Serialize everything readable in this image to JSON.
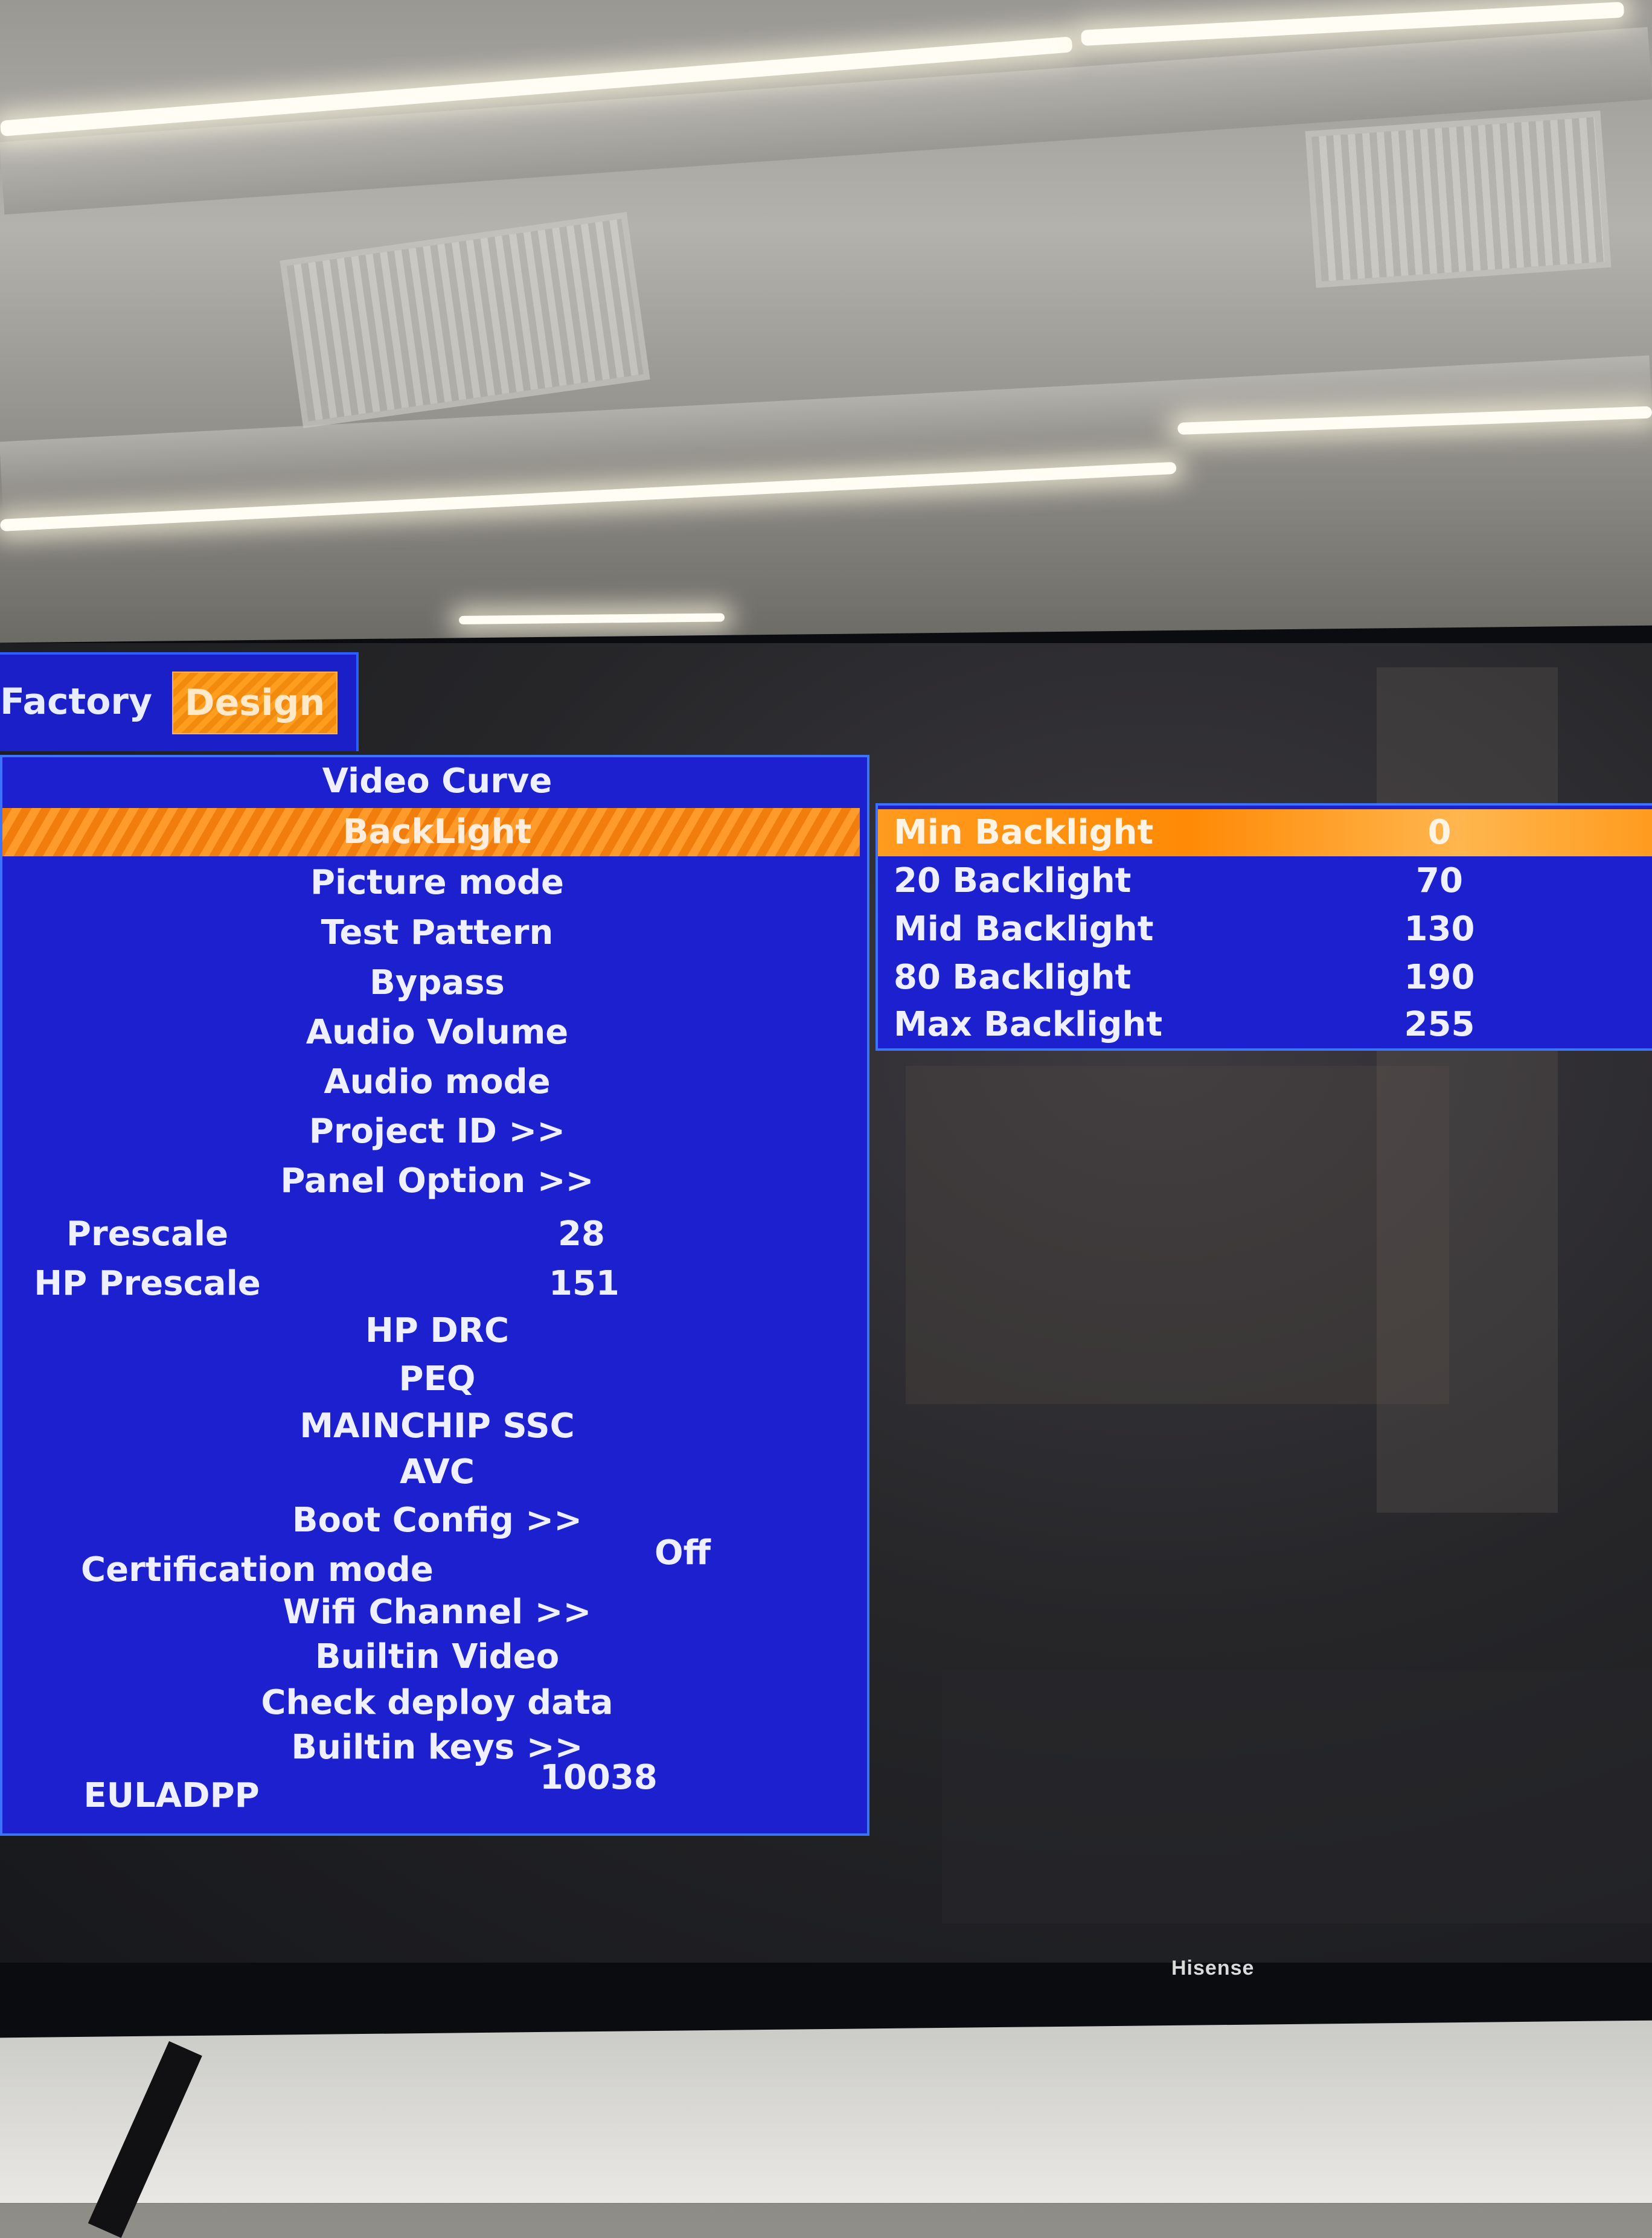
{
  "menu": {
    "tabs": [
      {
        "label": "Factory",
        "selected": false
      },
      {
        "label": "Design",
        "selected": true
      }
    ],
    "items": [
      {
        "label": "Video Curve",
        "value": "",
        "selected": false
      },
      {
        "label": "BackLight",
        "value": "",
        "selected": true
      },
      {
        "label": "Picture mode",
        "value": "",
        "selected": false
      },
      {
        "label": "Test Pattern",
        "value": "",
        "selected": false
      },
      {
        "label": "Bypass",
        "value": "",
        "selected": false
      },
      {
        "label": "Audio Volume",
        "value": "",
        "selected": false
      },
      {
        "label": "Audio mode",
        "value": "",
        "selected": false
      },
      {
        "label": "Project ID >>",
        "value": "",
        "selected": false
      },
      {
        "label": "Panel Option >>",
        "value": "",
        "selected": false
      },
      {
        "label": "Prescale",
        "value": "28",
        "selected": false
      },
      {
        "label": "HP Prescale",
        "value": "151",
        "selected": false
      },
      {
        "label": "HP DRC",
        "value": "",
        "selected": false
      },
      {
        "label": "PEQ",
        "value": "",
        "selected": false
      },
      {
        "label": "MAINCHIP SSC",
        "value": "",
        "selected": false
      },
      {
        "label": "AVC",
        "value": "",
        "selected": false
      },
      {
        "label": "Boot Config >>",
        "value": "",
        "selected": false
      },
      {
        "label": "Certification mode",
        "value": "Off",
        "selected": false
      },
      {
        "label": "Wifi Channel >>",
        "value": "",
        "selected": false
      },
      {
        "label": "Builtin  Video",
        "value": "",
        "selected": false
      },
      {
        "label": "Check deploy data",
        "value": "",
        "selected": false
      },
      {
        "label": "Builtin keys >>",
        "value": "",
        "selected": false
      },
      {
        "label": "EULADPP",
        "value": "10038",
        "selected": false
      }
    ]
  },
  "submenu": {
    "items": [
      {
        "label": "Min Backlight",
        "value": "0",
        "selected": true
      },
      {
        "label": "20 Backlight",
        "value": "70",
        "selected": false
      },
      {
        "label": "Mid Backlight",
        "value": "130",
        "selected": false
      },
      {
        "label": "80 Backlight",
        "value": "190",
        "selected": false
      },
      {
        "label": "Max Backlight",
        "value": "255",
        "selected": false
      }
    ]
  },
  "tv": {
    "brand": "Hisense"
  },
  "colors": {
    "menu_background": "#1d20cf",
    "menu_border": "#3a74ff",
    "highlight": "#ff9b1e",
    "text": "#eef0ff"
  }
}
